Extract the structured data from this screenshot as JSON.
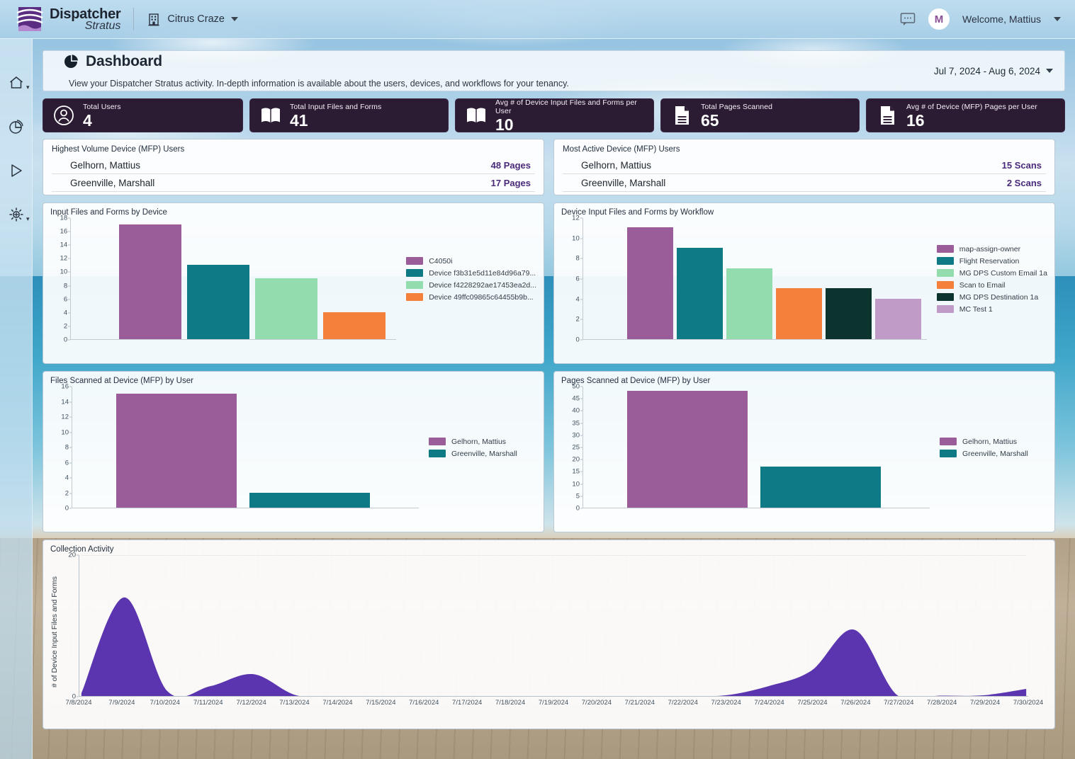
{
  "topbar": {
    "brand_line1": "Dispatcher",
    "brand_line2": "Stratus",
    "tenant": "Citrus Craze",
    "avatar_initial": "M",
    "welcome": "Welcome, Mattius"
  },
  "sidebar": {
    "items": [
      {
        "name": "home-icon",
        "label": "Home"
      },
      {
        "name": "pie-chart-icon",
        "label": "Reports"
      },
      {
        "name": "play-icon",
        "label": "Workflows"
      },
      {
        "name": "gear-icon",
        "label": "Settings"
      }
    ]
  },
  "page": {
    "title": "Dashboard",
    "subtitle": "View your Dispatcher Stratus activity. In-depth information is available about the users, devices, and workflows for your tenancy.",
    "date_range": "Jul 7, 2024 - Aug 6, 2024"
  },
  "kpis": [
    {
      "label": "Total Users",
      "value": "4",
      "icon": "user-circle-icon"
    },
    {
      "label": "Total Input Files and Forms",
      "value": "41",
      "icon": "book-icon"
    },
    {
      "label": "Avg # of Device Input Files and Forms per User",
      "value": "10",
      "icon": "book-icon"
    },
    {
      "label": "Total Pages Scanned",
      "value": "65",
      "icon": "document-icon"
    },
    {
      "label": "Avg # of Device (MFP) Pages per User",
      "value": "16",
      "icon": "document-icon"
    }
  ],
  "lists": [
    {
      "title": "Highest Volume Device (MFP) Users",
      "rows": [
        {
          "name": "Gelhorn, Mattius",
          "value": "48 Pages"
        },
        {
          "name": "Greenville, Marshall",
          "value": "17 Pages"
        }
      ]
    },
    {
      "title": "Most Active Device (MFP) Users",
      "rows": [
        {
          "name": "Gelhorn, Mattius",
          "value": "15 Scans"
        },
        {
          "name": "Greenville, Marshall",
          "value": "2 Scans"
        }
      ]
    }
  ],
  "chart_data": [
    {
      "id": "input-files-by-device",
      "type": "bar",
      "title": "Input Files and Forms by Device",
      "xlabel": "",
      "ylabel": "",
      "ylim": [
        0,
        18
      ],
      "yticks": [
        0,
        2,
        4,
        6,
        8,
        10,
        12,
        14,
        16,
        18
      ],
      "grid": false,
      "legend_position": "right",
      "categories": [
        "C4050i",
        "Device f3b31e5d11e84d96a79...",
        "Device f4228292ae17453ea2d...",
        "Device 49ffc09865c64455b9b..."
      ],
      "values": [
        17,
        11,
        9,
        4
      ],
      "colors": [
        "#9a5d9a",
        "#0e7a85",
        "#92dcad",
        "#f4803c"
      ]
    },
    {
      "id": "device-input-files-by-workflow",
      "type": "bar",
      "title": "Device Input Files and Forms by Workflow",
      "xlabel": "",
      "ylabel": "",
      "ylim": [
        0,
        12
      ],
      "yticks": [
        0,
        2,
        4,
        6,
        8,
        10,
        12
      ],
      "grid": false,
      "legend_position": "right",
      "categories": [
        "map-assign-owner",
        "Flight Reservation",
        "MG DPS Custom Email 1a",
        "Scan to Email",
        "MG DPS Destination 1a",
        "MC Test 1"
      ],
      "values": [
        11,
        9,
        7,
        5,
        5,
        4
      ],
      "colors": [
        "#9a5d9a",
        "#0e7a85",
        "#92dcad",
        "#f4803c",
        "#0d332f",
        "#c09bc8"
      ]
    },
    {
      "id": "files-scanned-by-user",
      "type": "bar",
      "title": "Files Scanned at Device (MFP) by User",
      "xlabel": "",
      "ylabel": "",
      "ylim": [
        0,
        16
      ],
      "yticks": [
        0,
        2,
        4,
        6,
        8,
        10,
        12,
        14,
        16
      ],
      "grid": false,
      "legend_position": "right",
      "categories": [
        "Gelhorn, Mattius",
        "Greenville, Marshall"
      ],
      "values": [
        15,
        2
      ],
      "colors": [
        "#9a5d9a",
        "#0e7a85"
      ]
    },
    {
      "id": "pages-scanned-by-user",
      "type": "bar",
      "title": "Pages Scanned at Device (MFP) by User",
      "xlabel": "",
      "ylabel": "",
      "ylim": [
        0,
        50
      ],
      "yticks": [
        0,
        5,
        10,
        15,
        20,
        25,
        30,
        35,
        40,
        45,
        50
      ],
      "grid": false,
      "legend_position": "right",
      "categories": [
        "Gelhorn, Mattius",
        "Greenville, Marshall"
      ],
      "values": [
        48,
        17
      ],
      "colors": [
        "#9a5d9a",
        "#0e7a85"
      ]
    },
    {
      "id": "collection-activity",
      "type": "area",
      "title": "Collection Activity",
      "xlabel": "",
      "ylabel": "# of Device Input Files and Forms",
      "ylim": [
        0,
        20
      ],
      "yticks": [
        0,
        20
      ],
      "grid": false,
      "color": "#5b35b0",
      "x": [
        "7/8/2024",
        "7/9/2024",
        "7/10/2024",
        "7/11/2024",
        "7/12/2024",
        "7/13/2024",
        "7/14/2024",
        "7/15/2024",
        "7/16/2024",
        "7/17/2024",
        "7/18/2024",
        "7/19/2024",
        "7/20/2024",
        "7/21/2024",
        "7/22/2024",
        "7/23/2024",
        "7/24/2024",
        "7/25/2024",
        "7/26/2024",
        "7/27/2024",
        "7/28/2024",
        "7/29/2024",
        "7/30/2024"
      ],
      "values": [
        0.4,
        14,
        0.7,
        1.4,
        3.1,
        0.1,
        0,
        0,
        0,
        0,
        0,
        0,
        0,
        0,
        0,
        0.1,
        1.4,
        3.6,
        9.4,
        0.1,
        0.05,
        0.1,
        1.0
      ]
    }
  ]
}
